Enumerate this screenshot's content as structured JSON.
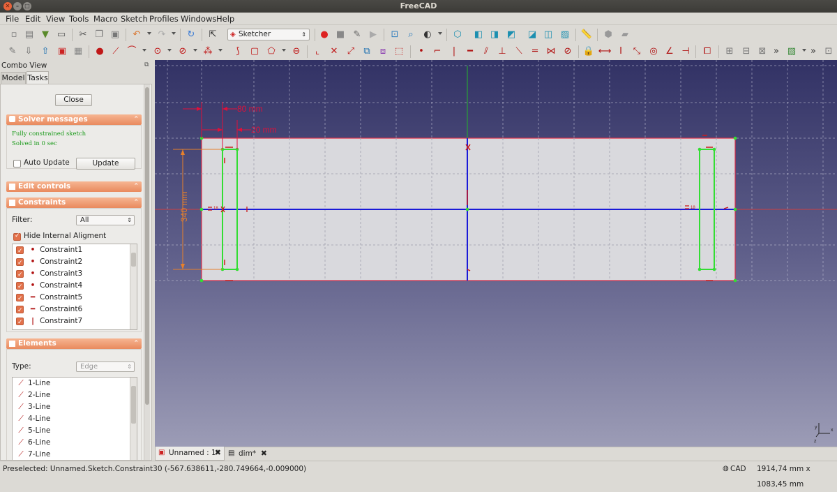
{
  "window": {
    "title": "FreeCAD"
  },
  "menu": [
    "File",
    "Edit",
    "View",
    "Tools",
    "Macro",
    "Sketch",
    "Profiles",
    "Windows",
    "Help"
  ],
  "workbench": "Sketcher",
  "combo": {
    "title": "Combo View",
    "tabs": [
      "Model",
      "Tasks"
    ],
    "close": "Close"
  },
  "solver": {
    "title": "Solver messages",
    "line1": "Fully constrained sketch",
    "line2": "Solved in 0 sec",
    "auto_update": "Auto Update",
    "update": "Update"
  },
  "edit_controls": {
    "title": "Edit controls"
  },
  "constraints": {
    "title": "Constraints",
    "filter_label": "Filter:",
    "filter_value": "All",
    "hide_internal": "Hide Internal Aligment",
    "items": [
      {
        "label": "Constraint1",
        "icon": "coincident-icon"
      },
      {
        "label": "Constraint2",
        "icon": "coincident-icon"
      },
      {
        "label": "Constraint3",
        "icon": "coincident-icon"
      },
      {
        "label": "Constraint4",
        "icon": "coincident-icon"
      },
      {
        "label": "Constraint5",
        "icon": "horizontal-icon"
      },
      {
        "label": "Constraint6",
        "icon": "horizontal-icon"
      },
      {
        "label": "Constraint7",
        "icon": "vertical-icon"
      }
    ]
  },
  "elements": {
    "title": "Elements",
    "type_label": "Type:",
    "type_value": "Edge",
    "items": [
      "1-Line",
      "2-Line",
      "3-Line",
      "4-Line",
      "5-Line",
      "6-Line",
      "7-Line"
    ]
  },
  "sketch": {
    "dim1": "80 mm",
    "dim2": "20 mm",
    "dim3": "340 mm",
    "sym_label": "18"
  },
  "doc_tabs": [
    {
      "label": "Unnamed : 1*"
    },
    {
      "label": "dim*"
    }
  ],
  "status": {
    "preselected": "Preselected: Unnamed.Sketch.Constraint30 (-567.638611,-280.749664,-0.009000)",
    "nav": "CAD",
    "dims": "1914,74 mm x 1083,45 mm"
  },
  "colors": {
    "accent": "#e98a5e",
    "sketch_green": "#33dd33",
    "constraint_red": "#cc1a1a",
    "bg_top": "#333366",
    "bg_bottom": "#9a9ab4"
  }
}
